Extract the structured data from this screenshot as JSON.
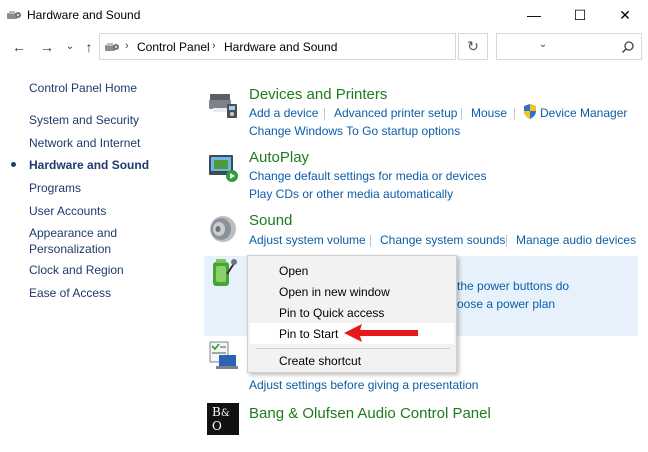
{
  "window": {
    "title": "Hardware and Sound",
    "minimize_glyph": "—",
    "maximize_glyph": "☐",
    "close_glyph": "✕"
  },
  "nav": {
    "back_glyph": "←",
    "forward_glyph": "→",
    "recent_glyph": "⌄",
    "up_glyph": "↑",
    "refresh_glyph": "↻",
    "dropdown_glyph": "⌄",
    "breadcrumb": [
      "Control Panel",
      "Hardware and Sound"
    ],
    "crumb_sep": "›",
    "search_placeholder": ""
  },
  "sidebar": {
    "items": [
      {
        "label": "Control Panel Home"
      },
      {
        "label": "System and Security"
      },
      {
        "label": "Network and Internet"
      },
      {
        "label": "Hardware and Sound",
        "current": true
      },
      {
        "label": "Programs"
      },
      {
        "label": "User Accounts"
      },
      {
        "label": "Appearance and"
      },
      {
        "label": "Personalization"
      },
      {
        "label": "Clock and Region"
      },
      {
        "label": "Ease of Access"
      }
    ]
  },
  "categories": {
    "devices": {
      "title": "Devices and Printers",
      "links": [
        "Add a device",
        "Advanced printer setup",
        "Mouse",
        "Device Manager",
        "Change Windows To Go startup options"
      ]
    },
    "autoplay": {
      "title": "AutoPlay",
      "links": [
        "Change default settings for media or devices",
        "Play CDs or other media automatically"
      ]
    },
    "sound": {
      "title": "Sound",
      "links": [
        "Adjust system volume",
        "Change system sounds",
        "Manage audio devices"
      ]
    },
    "power": {
      "links": [
        "the power buttons do",
        "oose a power plan"
      ]
    },
    "mobility": {
      "links": [
        "Adjust settings before giving a presentation"
      ]
    },
    "bang": {
      "title": "Bang & Olufsen Audio Control Panel",
      "logo_top": "B",
      "logo_amp": "&",
      "logo_bottom": "O"
    }
  },
  "context_menu": {
    "items": [
      "Open",
      "Open in new window",
      "Pin to Quick access",
      "Pin to Start",
      "Create shortcut"
    ],
    "highlighted": "Pin to Start"
  },
  "colors": {
    "link": "#0b5ea8",
    "category_title": "#1e7a1e",
    "sidebar_text": "#1f3a6e",
    "annotation_arrow": "#e8171a"
  }
}
